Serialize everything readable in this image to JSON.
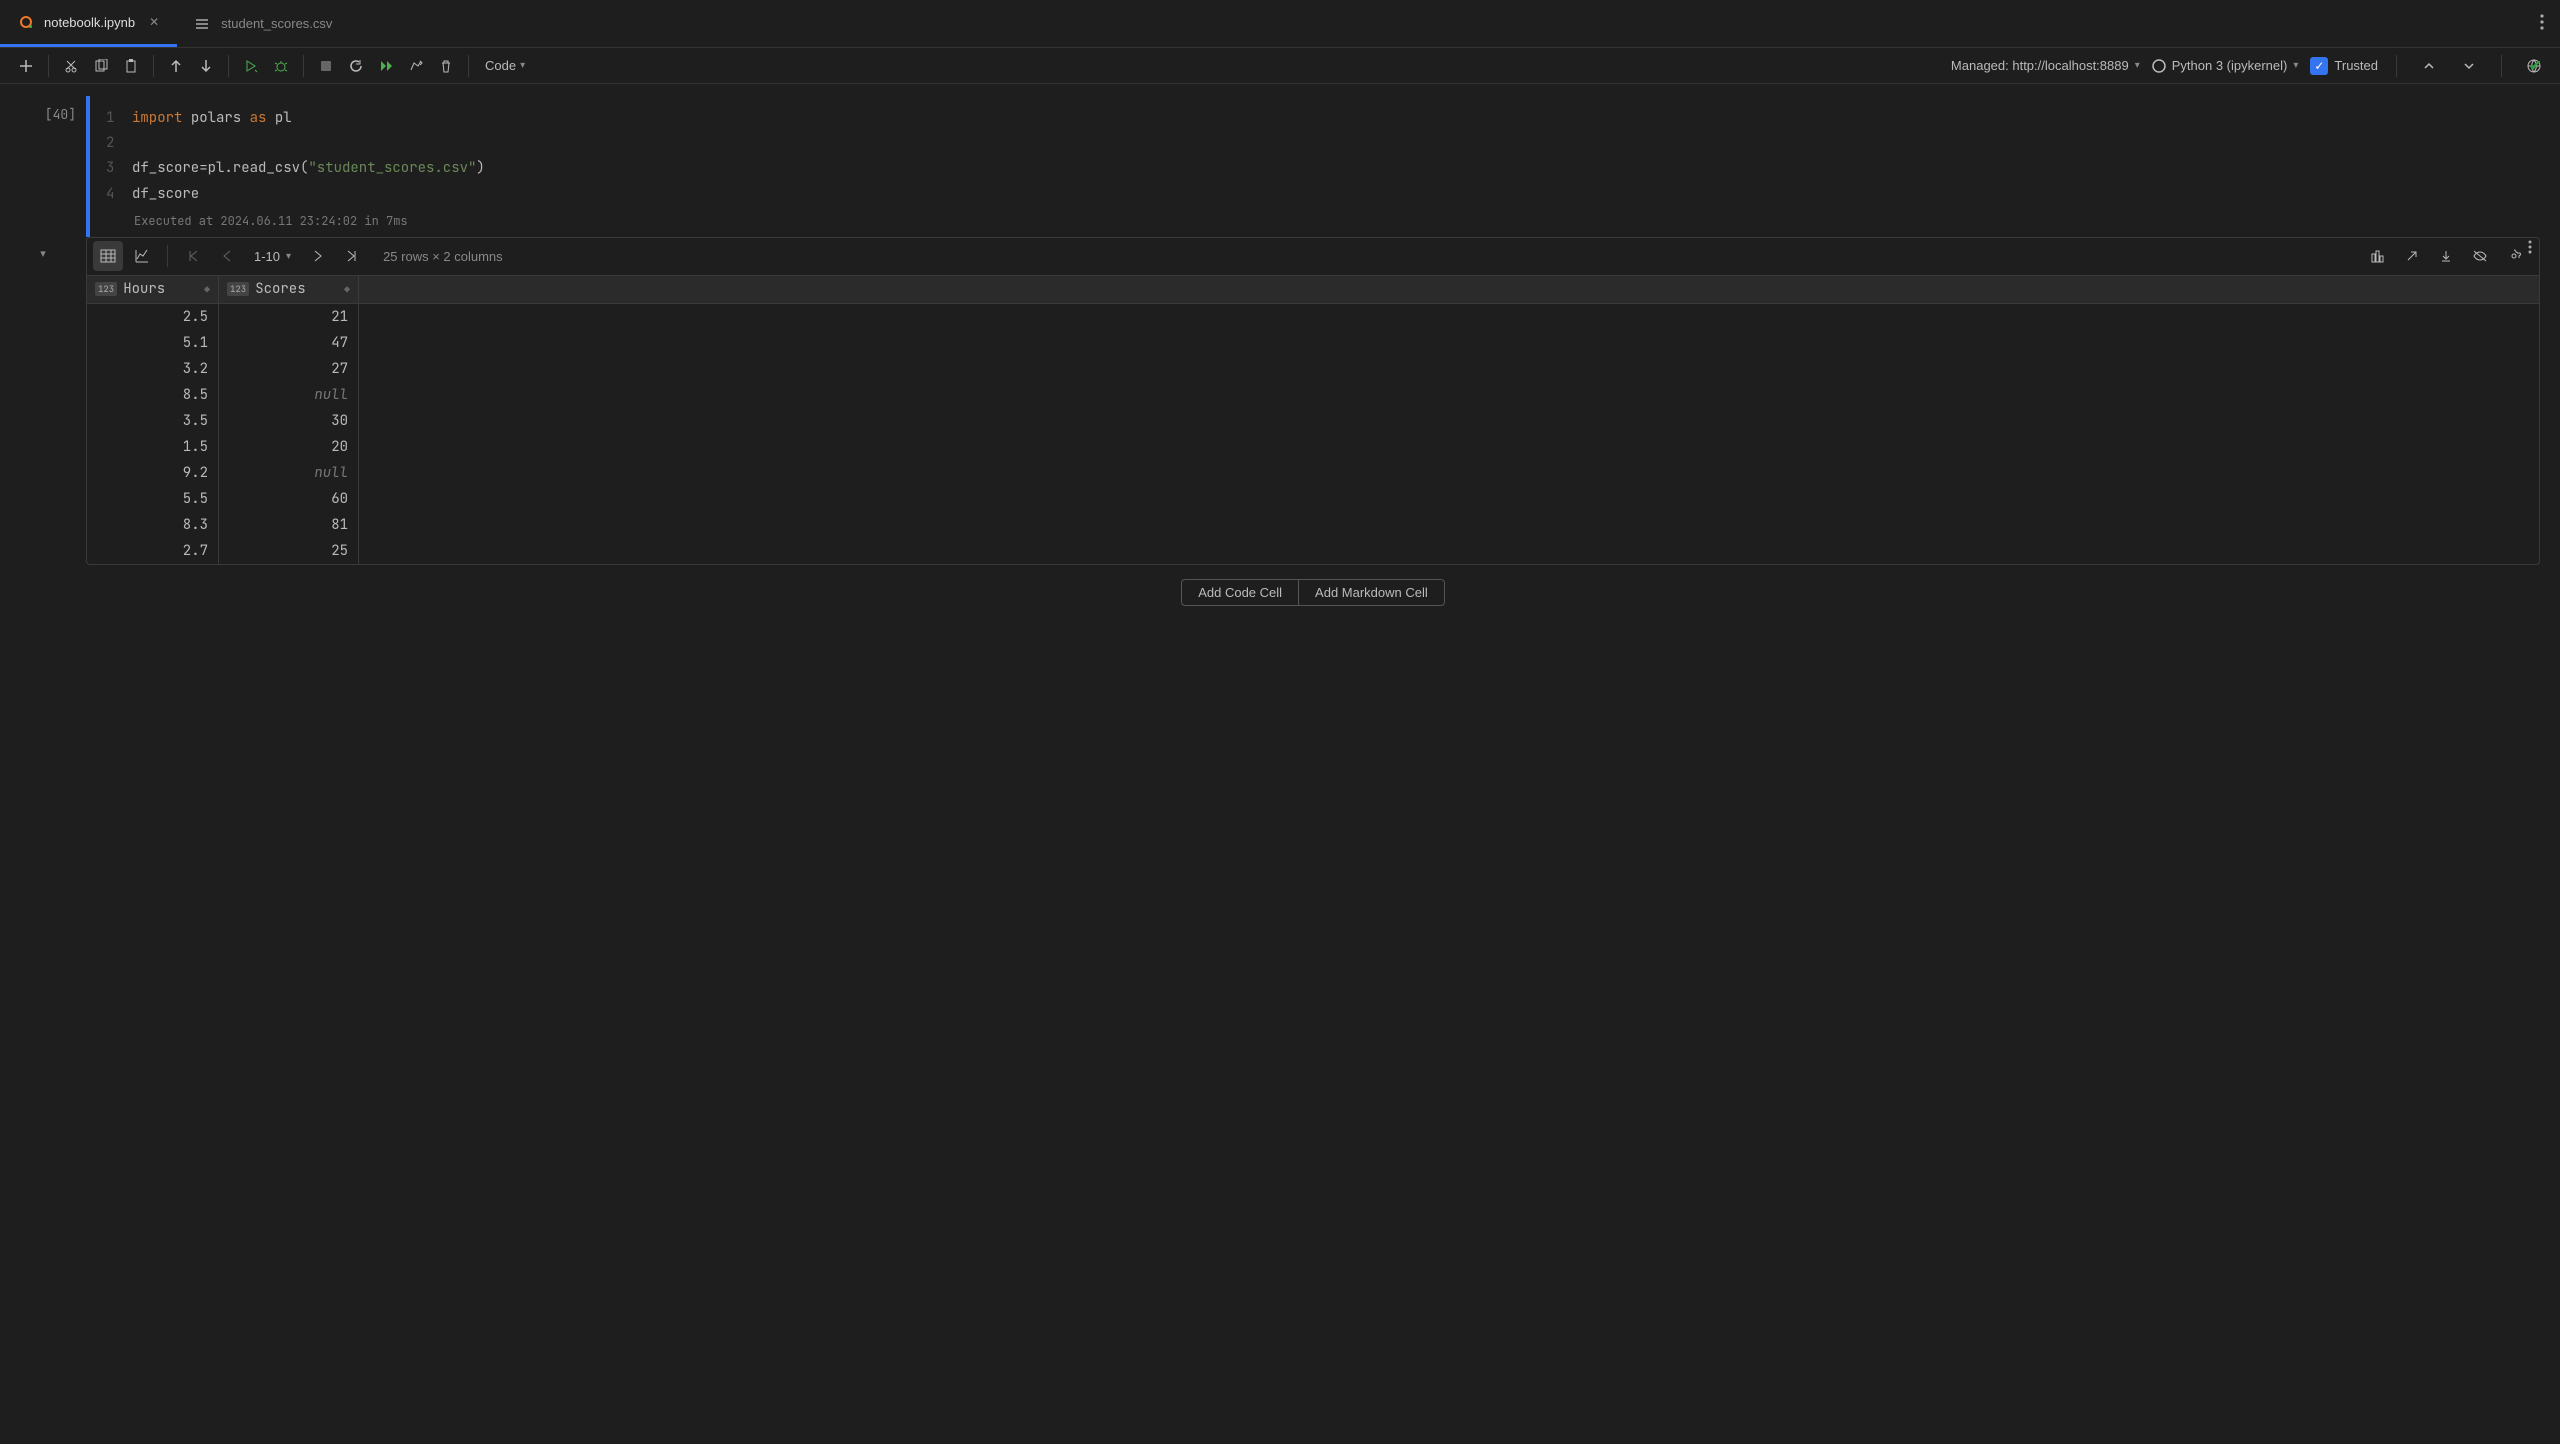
{
  "tabs": [
    {
      "label": "noteboolk.ipynb",
      "active": true
    },
    {
      "label": "student_scores.csv",
      "active": false
    }
  ],
  "toolbar": {
    "cell_type": "Code",
    "managed": "Managed: http://localhost:8889",
    "kernel": "Python 3 (ipykernel)",
    "trusted": "Trusted"
  },
  "cell": {
    "exec_count": "[40]",
    "code": {
      "l1_kw1": "import",
      "l1_id1": "polars",
      "l1_kw2": "as",
      "l1_id2": "pl",
      "l3_pre": "df_score=pl.read_csv(",
      "l3_str": "\"student_scores.csv\"",
      "l3_post": ")",
      "l4": "df_score"
    },
    "exec_meta": "Executed at 2024.06.11 23:24:02 in 7ms"
  },
  "dataviewer": {
    "page": "1-10",
    "summary": "25 rows × 2 columns",
    "columns": [
      {
        "name": "Hours",
        "type": "123"
      },
      {
        "name": "Scores",
        "type": "123"
      }
    ],
    "rows": [
      {
        "hours": "2.5",
        "scores": "21"
      },
      {
        "hours": "5.1",
        "scores": "47"
      },
      {
        "hours": "3.2",
        "scores": "27"
      },
      {
        "hours": "8.5",
        "scores": "null"
      },
      {
        "hours": "3.5",
        "scores": "30"
      },
      {
        "hours": "1.5",
        "scores": "20"
      },
      {
        "hours": "9.2",
        "scores": "null"
      },
      {
        "hours": "5.5",
        "scores": "60"
      },
      {
        "hours": "8.3",
        "scores": "81"
      },
      {
        "hours": "2.7",
        "scores": "25"
      }
    ]
  },
  "add_cells": {
    "code": "Add Code Cell",
    "markdown": "Add Markdown Cell"
  }
}
